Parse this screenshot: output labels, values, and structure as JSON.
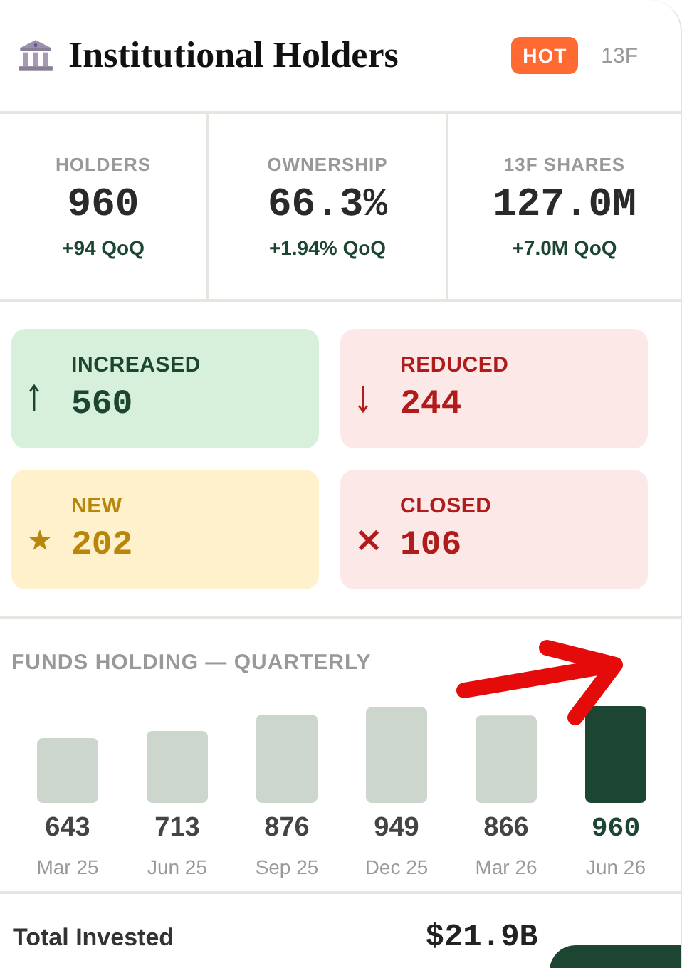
{
  "header": {
    "title": "Institutional Holders",
    "badge": "HOT",
    "tag": "13F"
  },
  "stats": [
    {
      "label": "HOLDERS",
      "value": "960",
      "change": "+94 QoQ"
    },
    {
      "label": "OWNERSHIP",
      "value": "66.3%",
      "change": "+1.94% QoQ"
    },
    {
      "label": "13F SHARES",
      "value": "127.0M",
      "change": "+7.0M QoQ"
    }
  ],
  "activity": [
    {
      "kind": "increased",
      "label": "INCREASED",
      "value": "560"
    },
    {
      "kind": "reduced",
      "label": "REDUCED",
      "value": "244"
    },
    {
      "kind": "new",
      "label": "NEW",
      "value": "202"
    },
    {
      "kind": "closed",
      "label": "CLOSED",
      "value": "106"
    }
  ],
  "funds_chart": {
    "title": "FUNDS HOLDING — QUARTERLY",
    "chart_data": {
      "type": "bar",
      "categories": [
        "Mar 25",
        "Jun 25",
        "Sep 25",
        "Dec 25",
        "Mar 26",
        "Jun 26"
      ],
      "data_labels": true,
      "series": [
        {
          "color": "#ccd6cc",
          "values": [
            643,
            713,
            876,
            949,
            866,
            null
          ]
        },
        {
          "color": "#1c4532",
          "values": [
            null,
            null,
            null,
            null,
            null,
            960
          ]
        }
      ]
    }
  },
  "summary": {
    "label": "Total Invested",
    "value": "$21.9B"
  }
}
